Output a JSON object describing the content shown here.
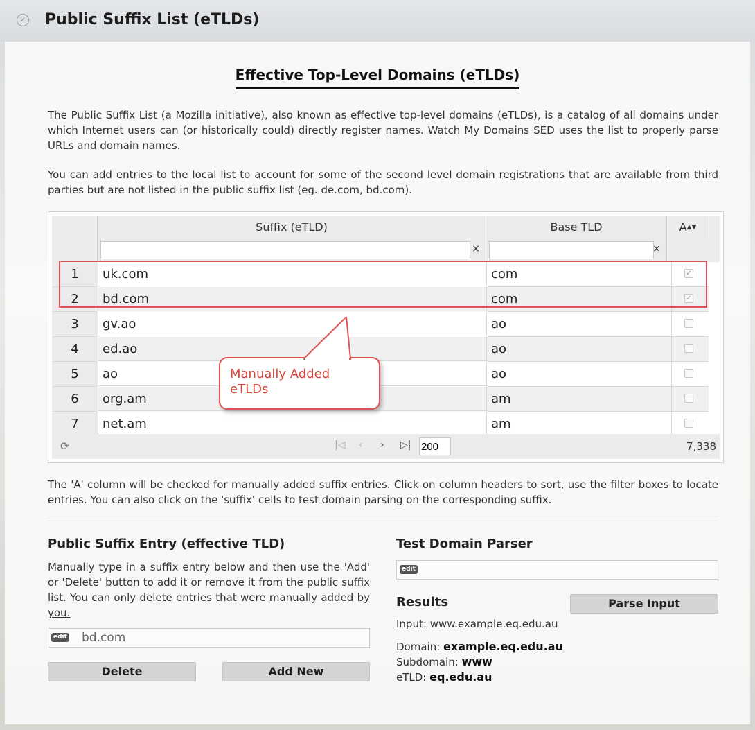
{
  "window": {
    "title": "Public Suffix List (eTLDs)"
  },
  "heading": "Effective Top-Level Domains (eTLDs)",
  "intro": [
    "The Public Suffix List (a Mozilla initiative), also known as effective top-level domains (eTLDs), is a catalog of all domains under which Internet users can (or historically could) directly register names. Watch My Domains SED uses the list to properly parse URLs and domain names.",
    "You can add entries to the local list to account for some of the second level domain registrations that are available from third parties but are not listed in the public suffix list (eg. de.com, bd.com)."
  ],
  "grid": {
    "columns": [
      "Suffix (eTLD)",
      "Base TLD",
      "A"
    ],
    "sort_icon": "sort-icon",
    "filter_clear": "×",
    "rows": [
      {
        "n": "1",
        "suffix": "uk.com",
        "tld": "com",
        "added": true
      },
      {
        "n": "2",
        "suffix": "bd.com",
        "tld": "com",
        "added": true
      },
      {
        "n": "3",
        "suffix": "gv.ao",
        "tld": "ao",
        "added": false
      },
      {
        "n": "4",
        "suffix": "ed.ao",
        "tld": "ao",
        "added": false
      },
      {
        "n": "5",
        "suffix": "ao",
        "tld": "ao",
        "added": false
      },
      {
        "n": "6",
        "suffix": "org.am",
        "tld": "am",
        "added": false
      },
      {
        "n": "7",
        "suffix": "net.am",
        "tld": "am",
        "added": false
      }
    ],
    "page_size": "200",
    "total": "7,338"
  },
  "callout": {
    "line1": "Manually Added",
    "line2": "eTLDs",
    "color": "#e05252"
  },
  "note": "The 'A' column will be checked for manually added suffix entries. Click on column headers to sort, use the filter boxes to locate entries. You can also click on the 'suffix' cells to test domain parsing on the corresponding suffix.",
  "entry": {
    "title": "Public Suffix Entry (effective TLD)",
    "desc": "Manually type in a suffix entry below and then use the 'Add' or 'Delete' button to add it or remove it from the public suffix list. You can only delete entries that were ",
    "desc_link": "manually added by you.",
    "badge": "edit",
    "value": "bd.com",
    "delete_label": "Delete",
    "add_label": "Add New"
  },
  "parser": {
    "title": "Test Domain Parser",
    "badge": "edit",
    "parse_label": "Parse Input",
    "results_title": "Results",
    "input_label": "Input:",
    "input_value": "www.example.eq.edu.au",
    "domain_label": "Domain:",
    "domain_value": "example.eq.edu.au",
    "subdomain_label": "Subdomain:",
    "subdomain_value": "www",
    "etld_label": "eTLD:",
    "etld_value": "eq.edu.au"
  }
}
